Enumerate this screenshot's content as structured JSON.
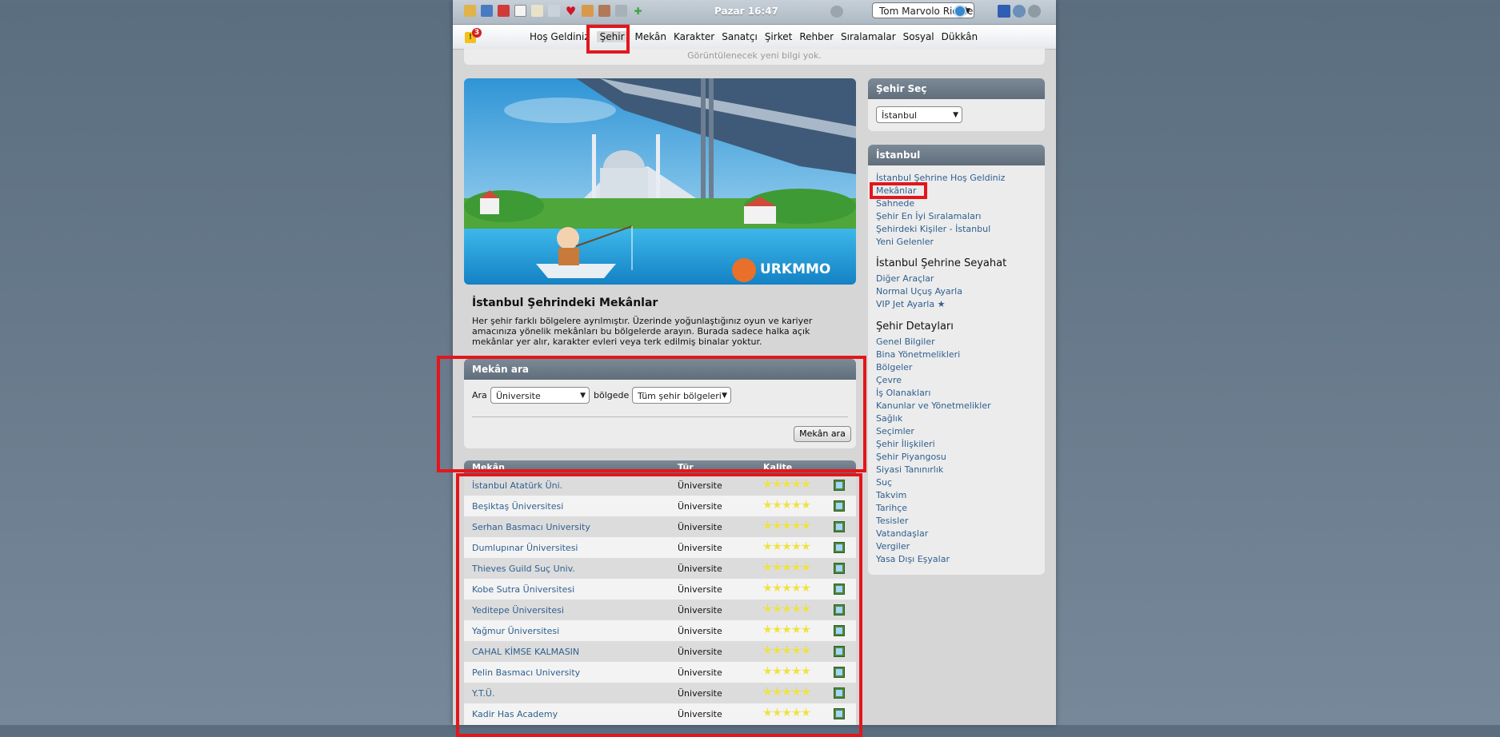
{
  "clock": "Pazar 16:47",
  "character_select": "Tom Marvolo Riddle",
  "alerts_count": "3",
  "alert_glyph": "!",
  "nav": [
    "Hoş Geldiniz",
    "Şehir",
    "Mekân",
    "Karakter",
    "Sanatçı",
    "Şirket",
    "Rehber",
    "Sıralamalar",
    "Sosyal",
    "Dükkân"
  ],
  "info_message": "Görüntülenecek yeni bilgi yok.",
  "banner_logo": "URKMMO",
  "page_title": "İstanbul Şehrindeki Mekânlar",
  "description": "Her şehir farklı bölgelere ayrılmıştır. Üzerinde yoğunlaştığınız oyun ve kariyer amacınıza yönelik mekânları bu bölgelerde arayın. Burada sadece halka açık mekânlar yer alır, karakter evleri veya terk edilmiş binalar yoktur.",
  "search": {
    "title": "Mekân ara",
    "label_search": "Ara",
    "type_value": "Üniversite",
    "label_region": "bölgede",
    "region_value": "Tüm şehir bölgeleri",
    "button": "Mekân ara"
  },
  "table": {
    "headers": [
      "Mekân",
      "Tür",
      "Kalite"
    ],
    "rows": [
      {
        "name": "İstanbul Atatürk Üni.",
        "type": "Üniversite",
        "quality": 5
      },
      {
        "name": "Beşiktaş Üniversitesi",
        "type": "Üniversite",
        "quality": 5
      },
      {
        "name": "Serhan Basmacı University",
        "type": "Üniversite",
        "quality": 5
      },
      {
        "name": "Dumlupınar Üniversitesi",
        "type": "Üniversite",
        "quality": 5
      },
      {
        "name": "Thieves Guild Suç Univ.",
        "type": "Üniversite",
        "quality": 5
      },
      {
        "name": "Kobe Sutra Üniversitesi",
        "type": "Üniversite",
        "quality": 5
      },
      {
        "name": "Yeditepe Üniversitesi",
        "type": "Üniversite",
        "quality": 5
      },
      {
        "name": "Yağmur Üniversitesi",
        "type": "Üniversite",
        "quality": 5
      },
      {
        "name": "CAHAL KİMSE KALMASIN",
        "type": "Üniversite",
        "quality": 5
      },
      {
        "name": "Pelin Basmacı University",
        "type": "Üniversite",
        "quality": 5
      },
      {
        "name": "Y.T.Ü.",
        "type": "Üniversite",
        "quality": 5
      },
      {
        "name": "Kadir Has Academy",
        "type": "Üniversite",
        "quality": 5
      }
    ]
  },
  "city_select": {
    "title": "Şehir Seç",
    "value": "İstanbul"
  },
  "city_panel": {
    "title": "İstanbul",
    "links1": [
      "İstanbul Şehrine Hoş Geldiniz",
      "Mekânlar",
      "Sahnede",
      "Şehir En İyi Sıralamaları",
      "Şehirdeki Kişiler - İstanbul",
      "Yeni Gelenler"
    ],
    "travel_title": "İstanbul Şehrine Seyahat",
    "links2": [
      "Diğer Araçlar",
      "Normal Uçuş Ayarla",
      "VIP Jet Ayarla ★"
    ],
    "details_title": "Şehir Detayları",
    "links3": [
      "Genel Bilgiler",
      "Bina Yönetmelikleri",
      "Bölgeler",
      "Çevre",
      "İş Olanakları",
      "Kanunlar ve Yönetmelikler",
      "Sağlık",
      "Seçimler",
      "Şehir İlişkileri",
      "Şehir Piyangosu",
      "Siyasi Tanınırlık",
      "Suç",
      "Takvim",
      "Tarihçe",
      "Tesisler",
      "Vatandaşlar",
      "Vergiler",
      "Yasa Dışı Eşyalar"
    ]
  }
}
